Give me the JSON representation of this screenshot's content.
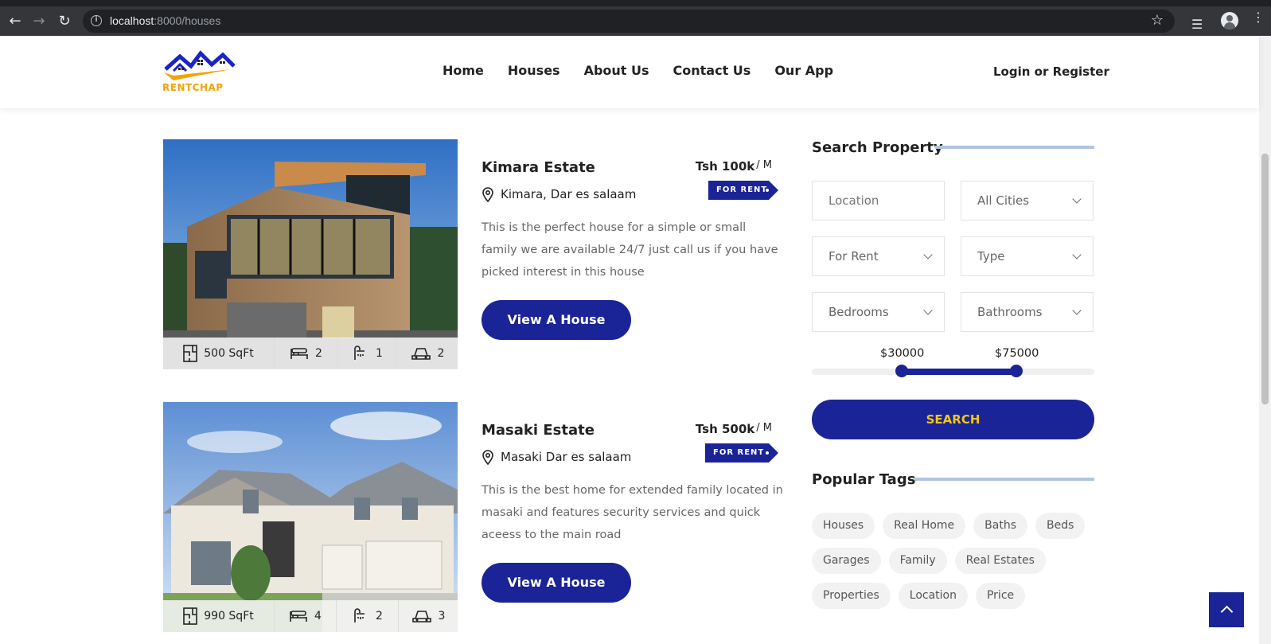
{
  "browser": {
    "url_host": "localhost",
    "url_path": ":8000/houses"
  },
  "header": {
    "logo_text": "RENTCHAP",
    "nav": [
      "Home",
      "Houses",
      "About Us",
      "Contact Us",
      "Our App"
    ],
    "login": "Login or Register"
  },
  "listings": [
    {
      "title": "Kimara Estate",
      "location": "Kimara, Dar es salaam",
      "price": "Tsh 100k",
      "per": "/ M",
      "tag": "FOR RENT",
      "description": "This is the perfect house for a simple or small family we are available 24/7 just call us if you have picked interest in this house",
      "button": "View A House",
      "area": "500 SqFt",
      "beds": "2",
      "baths": "1",
      "garages": "2"
    },
    {
      "title": "Masaki Estate",
      "location": "Masaki Dar es salaam",
      "price": "Tsh 500k",
      "per": "/ M",
      "tag": "FOR RENT",
      "description": "This is the best home for extended family located in masaki and features security services and quick aceess to the main road",
      "button": "View A House",
      "area": "990 SqFt",
      "beds": "4",
      "baths": "2",
      "garages": "3"
    }
  ],
  "search": {
    "heading": "Search Property",
    "location_placeholder": "Location",
    "city": "All Cities",
    "status": "For Rent",
    "type": "Type",
    "bedrooms": "Bedrooms",
    "bathrooms": "Bathrooms",
    "min_price": "$30000",
    "max_price": "$75000",
    "button": "SEARCH"
  },
  "tags": {
    "heading": "Popular Tags",
    "items": [
      "Houses",
      "Real Home",
      "Baths",
      "Beds",
      "Garages",
      "Family",
      "Real Estates",
      "Properties",
      "Location",
      "Price"
    ]
  }
}
